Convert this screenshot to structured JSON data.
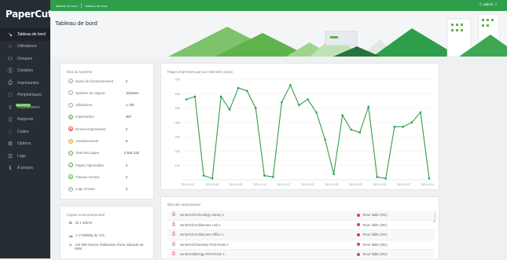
{
  "app": {
    "logo_main": "PaperCut",
    "logo_suffix": "NG"
  },
  "sidebar": {
    "items": [
      {
        "label": "Tableau de bord",
        "icon": "dashboard-icon",
        "glyph": "↘"
      },
      {
        "label": "Utilisateurs",
        "icon": "user-icon",
        "glyph": "○"
      },
      {
        "label": "Groupes",
        "icon": "group-icon",
        "glyph": "⚇"
      },
      {
        "label": "Comptes",
        "icon": "account-icon",
        "glyph": "Ⓢ"
      },
      {
        "label": "Imprimantes",
        "icon": "printer-icon",
        "glyph": "⎙"
      },
      {
        "label": "Périphériques",
        "icon": "device-icon",
        "glyph": "□"
      },
      {
        "label": "Déploiement",
        "icon": "deploy-icon",
        "glyph": "⇧",
        "badge": "NOUVEAU"
      },
      {
        "label": "Rapports",
        "icon": "report-icon",
        "glyph": "▯"
      },
      {
        "label": "Codes",
        "icon": "code-icon",
        "glyph": "♢"
      },
      {
        "label": "Options",
        "icon": "options-icon",
        "glyph": "⚙"
      },
      {
        "label": "Logs",
        "icon": "logs-icon",
        "glyph": "☰"
      },
      {
        "label": "À propos",
        "icon": "about-icon",
        "glyph": "ℹ"
      }
    ]
  },
  "topbar": {
    "crumb1": "Tableau de bord",
    "crumb2": "Tableau de bord",
    "user": "ⓘ  admin ∨"
  },
  "hero": {
    "title": "Tableau de bord"
  },
  "status": {
    "title": "État du système",
    "rows": [
      {
        "label": "Durée de fonctionnement",
        "value": "2",
        "icon": "clock-icon",
        "glyph": "◷",
        "color": "#9aa3aa"
      },
      {
        "label": "Système de rapport",
        "value": "16/16ms",
        "icon": "activity-icon",
        "glyph": "~",
        "color": "#9aa3aa"
      },
      {
        "label": "Utilisateurs",
        "value": "1 726",
        "icon": "user-icon",
        "glyph": "○",
        "color": "#9aa3aa"
      },
      {
        "label": "Imprimantes",
        "value": "367",
        "icon": "printer-icon",
        "glyph": "⎙",
        "color": "#5fb34a"
      },
      {
        "label": "Erreurs imprimantes",
        "value": "2",
        "icon": "error-icon",
        "glyph": "✖",
        "color": "#e23d54"
      },
      {
        "label": "Avertissements",
        "value": "8",
        "icon": "warning-icon",
        "glyph": "▲",
        "color": "#f0a020"
      },
      {
        "label": "Total des pages",
        "value": "2 915 132",
        "icon": "page-icon",
        "glyph": "▭",
        "color": "#5fb34a"
      },
      {
        "label": "Pages imprimables",
        "value": "2",
        "icon": "page-icon",
        "glyph": "▭",
        "color": "#5fb34a"
      },
      {
        "label": "Travaux récents",
        "value": "2",
        "icon": "job-icon",
        "glyph": "▤",
        "color": "#5fb34a"
      },
      {
        "label": "Logs récents",
        "value": "2",
        "icon": "log-icon",
        "glyph": "☰",
        "color": "#9aa3aa"
      }
    ]
  },
  "chart_data": {
    "type": "line",
    "title": "Pages imprimées par jour (derniers jours)",
    "xlabel": "",
    "ylabel": "",
    "ylim": [
      0,
      700
    ],
    "yticks": [
      "700",
      "600",
      "500",
      "400",
      "300",
      "200",
      "100"
    ],
    "xticks": [
      "2021-11-01",
      "2021-11-05",
      "2021-11-09",
      "2021-11-13",
      "2021-11-17",
      "2021-11-21",
      "2021-11-25",
      "2021-11-29",
      "2021-12-03",
      "2021-12-07",
      "2021-12-11"
    ],
    "series": [
      {
        "color": "#2e9e4b",
        "values": [
          560,
          580,
          30,
          10,
          580,
          490,
          640,
          620,
          500,
          30,
          20,
          540,
          660,
          520,
          560,
          470,
          280,
          40,
          450,
          350,
          330,
          510,
          20,
          10,
          370,
          370,
          400,
          470,
          10
        ]
      }
    ]
  },
  "env": {
    "title": "Impact environnemental",
    "rows": [
      {
        "text": "20,1 arbres",
        "icon": "tree-icon",
        "glyph": "☘"
      },
      {
        "text": "1 174986kg de CO₂",
        "icon": "co2-icon",
        "glyph": "☁"
      },
      {
        "text": "124 880 heures d'utilisation d'une ampoule de 60W",
        "icon": "bulb-icon",
        "glyph": "☀"
      }
    ]
  },
  "printers": {
    "title": "État des imprimantes",
    "rows": [
      {
        "name": "server01\\Technology Library 1",
        "status": "Toner faible (9%)"
      },
      {
        "name": "server01\\Architecture Lab 1",
        "status": "Toner faible (9%)"
      },
      {
        "name": "server01\\Architecture Office 1",
        "status": "Toner faible (9%)"
      },
      {
        "name": "server01\\Chemistry Print Room 1",
        "status": "Toner faible (9%)"
      },
      {
        "name": "server01\\Biology Print Room 1",
        "status": "Toner faible (9%)"
      }
    ]
  }
}
